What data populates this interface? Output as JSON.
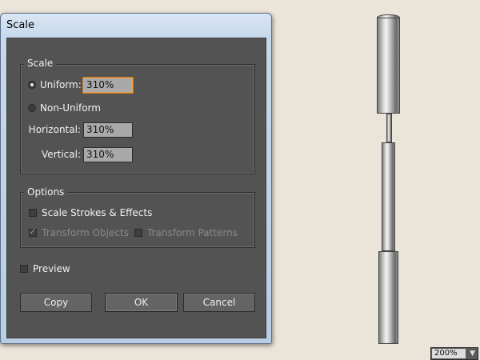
{
  "dialog": {
    "title": "Scale",
    "scale_group": {
      "legend": "Scale",
      "uniform_label": "Uniform:",
      "uniform_value": "310%",
      "non_uniform_label": "Non-Uniform",
      "horizontal_label": "Horizontal:",
      "horizontal_value": "310%",
      "vertical_label": "Vertical:",
      "vertical_value": "310%"
    },
    "options_group": {
      "legend": "Options",
      "scale_strokes_label": "Scale Strokes & Effects",
      "transform_objects_label": "Transform Objects",
      "transform_patterns_label": "Transform Patterns"
    },
    "preview_label": "Preview",
    "buttons": {
      "copy": "Copy",
      "ok": "OK",
      "cancel": "Cancel"
    }
  },
  "zoom": {
    "value": "200%",
    "arrow": "▼"
  }
}
